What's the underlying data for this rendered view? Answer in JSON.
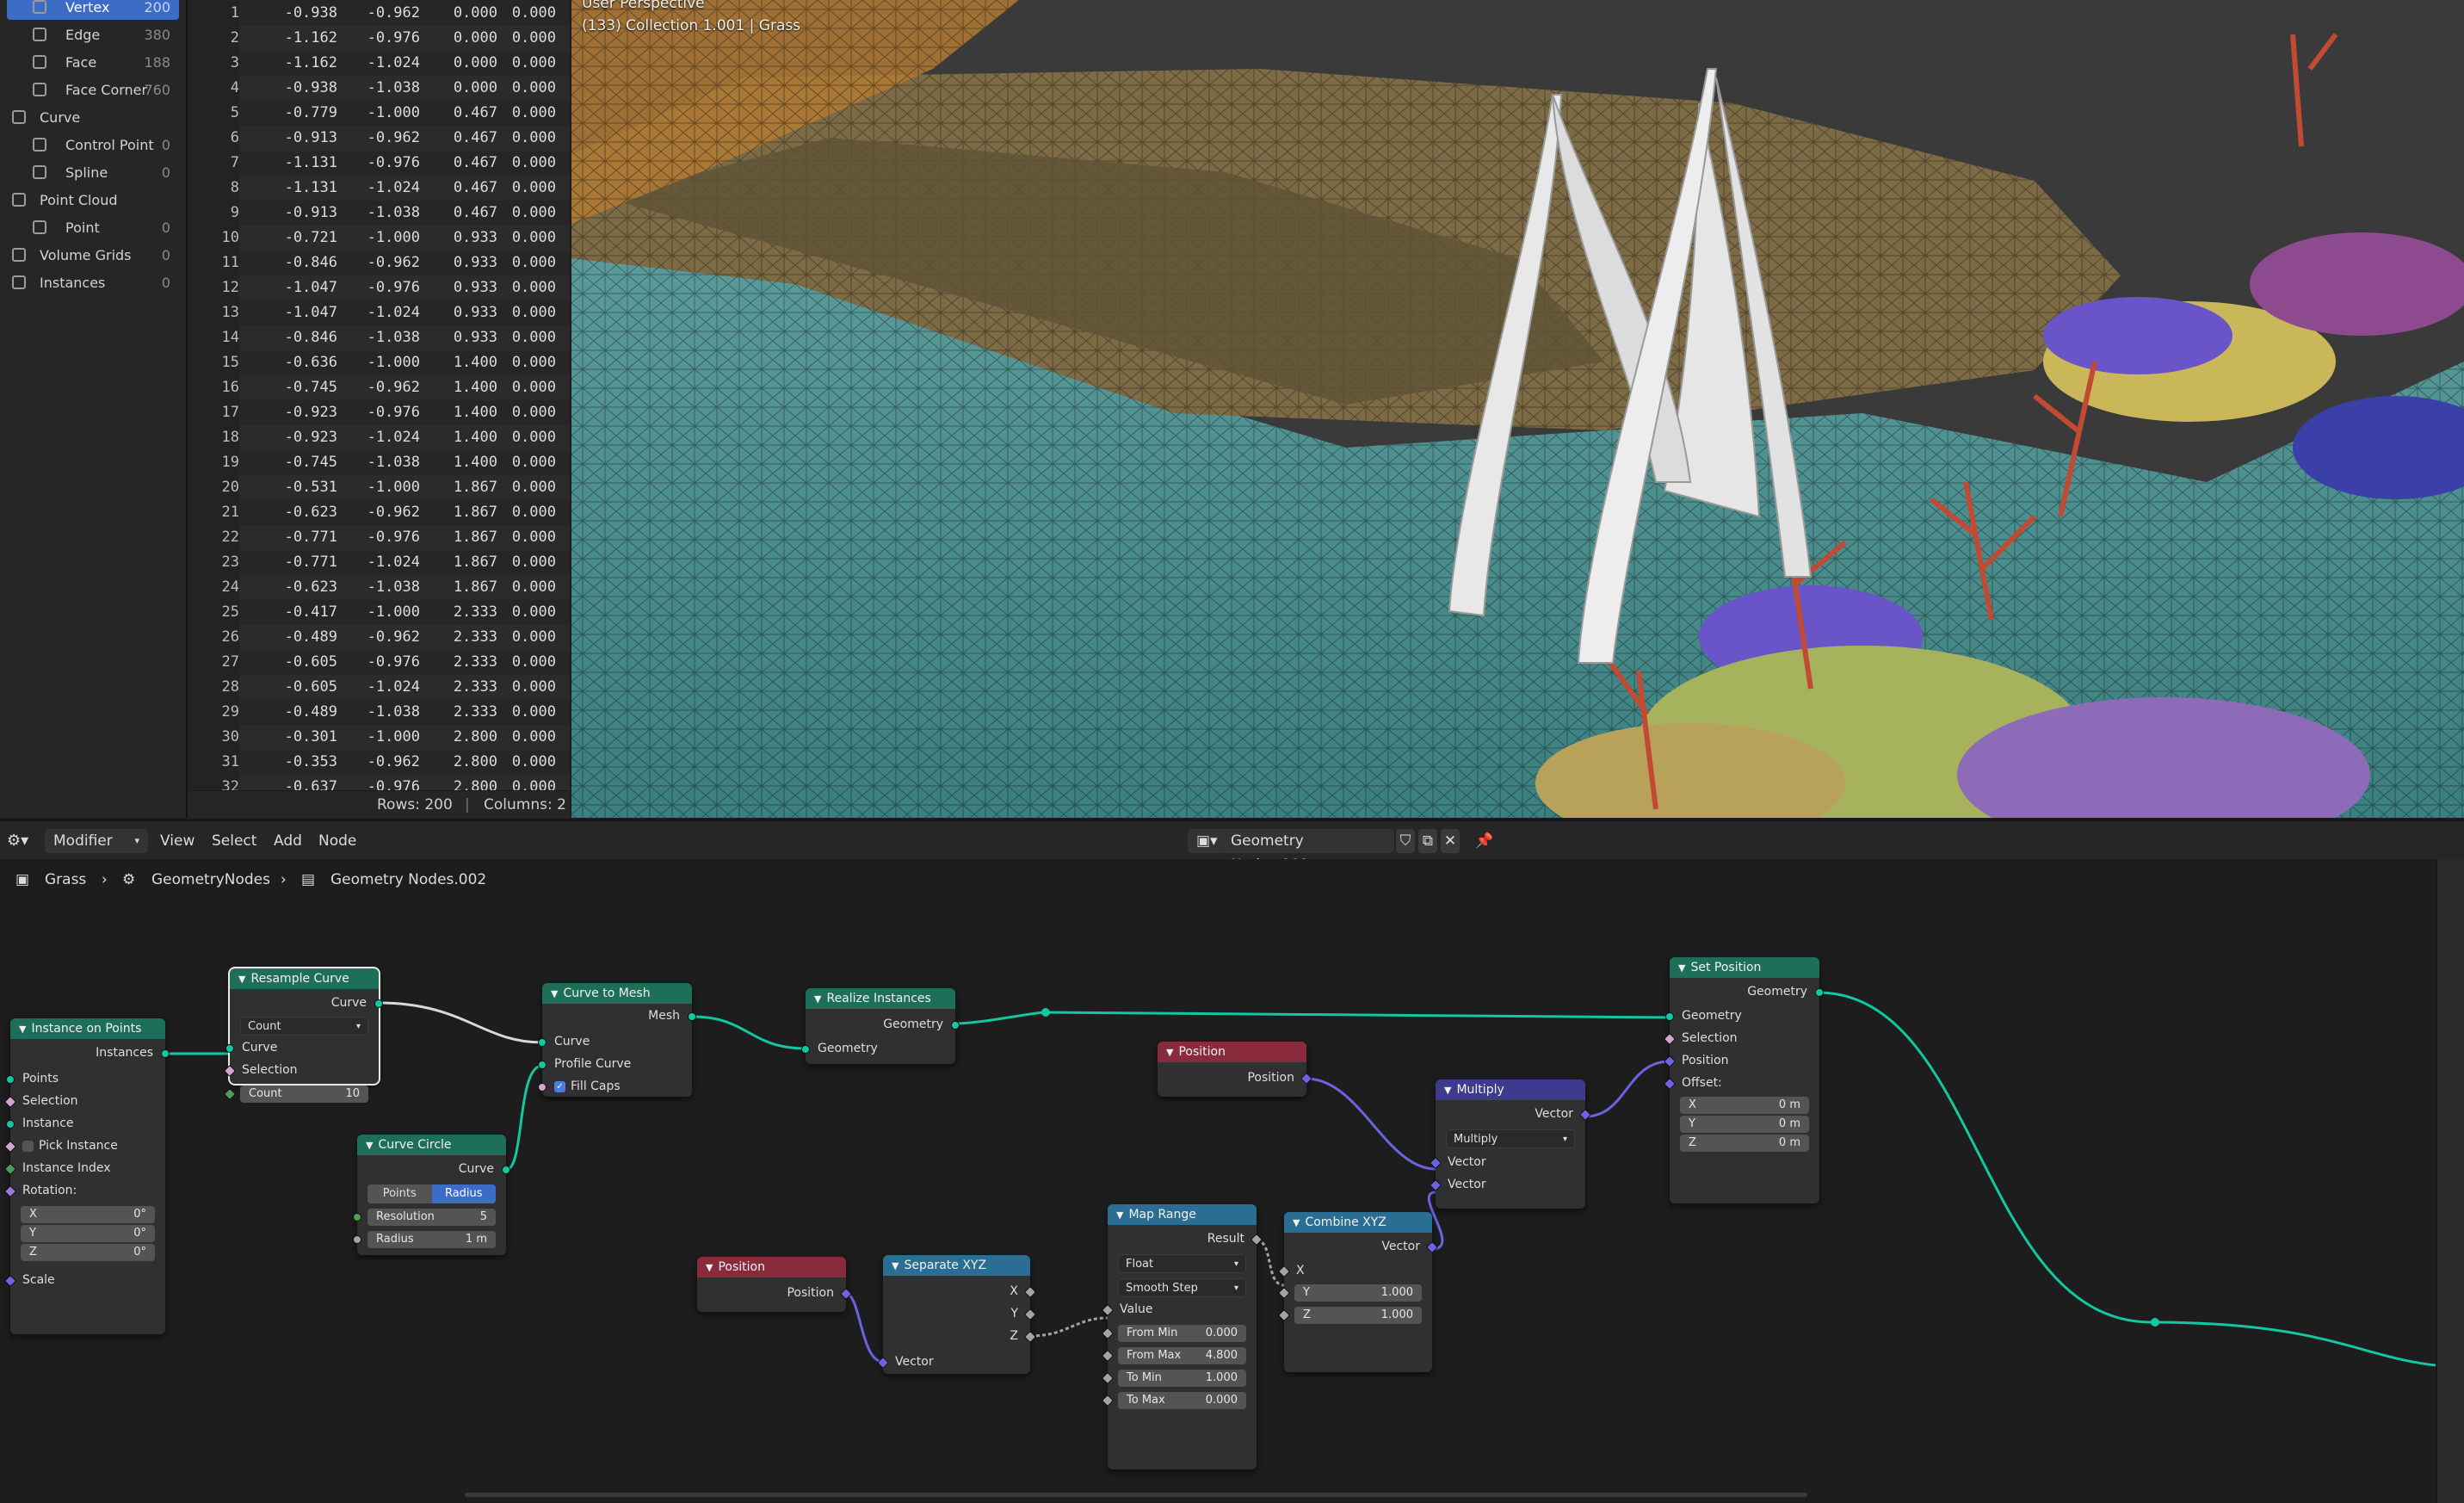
{
  "side_panel": {
    "items": [
      {
        "label": "Vertex",
        "count": "200",
        "icon": "vertex-icon",
        "active": true,
        "indent": true
      },
      {
        "label": "Edge",
        "count": "380",
        "icon": "edge-icon",
        "indent": true
      },
      {
        "label": "Face",
        "count": "188",
        "icon": "face-icon",
        "indent": true
      },
      {
        "label": "Face Corner",
        "count": "760",
        "icon": "face-corner-icon",
        "indent": true
      },
      {
        "label": "Curve",
        "count": "",
        "icon": "curve-icon",
        "indent": false
      },
      {
        "label": "Control Point",
        "count": "0",
        "icon": "control-point-icon",
        "indent": true
      },
      {
        "label": "Spline",
        "count": "0",
        "icon": "spline-icon",
        "indent": true
      },
      {
        "label": "Point Cloud",
        "count": "",
        "icon": "point-cloud-icon",
        "indent": false
      },
      {
        "label": "Point",
        "count": "0",
        "icon": "point-icon",
        "indent": true
      },
      {
        "label": "Volume Grids",
        "count": "0",
        "icon": "volume-grids-icon",
        "indent": false
      },
      {
        "label": "Instances",
        "count": "0",
        "icon": "instances-icon",
        "indent": false
      }
    ]
  },
  "spreadsheet": {
    "rows": [
      [
        "1",
        "-0.938",
        "-0.962",
        "0.000",
        "0.000"
      ],
      [
        "2",
        "-1.162",
        "-0.976",
        "0.000",
        "0.000"
      ],
      [
        "3",
        "-1.162",
        "-1.024",
        "0.000",
        "0.000"
      ],
      [
        "4",
        "-0.938",
        "-1.038",
        "0.000",
        "0.000"
      ],
      [
        "5",
        "-0.779",
        "-1.000",
        "0.467",
        "0.000"
      ],
      [
        "6",
        "-0.913",
        "-0.962",
        "0.467",
        "0.000"
      ],
      [
        "7",
        "-1.131",
        "-0.976",
        "0.467",
        "0.000"
      ],
      [
        "8",
        "-1.131",
        "-1.024",
        "0.467",
        "0.000"
      ],
      [
        "9",
        "-0.913",
        "-1.038",
        "0.467",
        "0.000"
      ],
      [
        "10",
        "-0.721",
        "-1.000",
        "0.933",
        "0.000"
      ],
      [
        "11",
        "-0.846",
        "-0.962",
        "0.933",
        "0.000"
      ],
      [
        "12",
        "-1.047",
        "-0.976",
        "0.933",
        "0.000"
      ],
      [
        "13",
        "-1.047",
        "-1.024",
        "0.933",
        "0.000"
      ],
      [
        "14",
        "-0.846",
        "-1.038",
        "0.933",
        "0.000"
      ],
      [
        "15",
        "-0.636",
        "-1.000",
        "1.400",
        "0.000"
      ],
      [
        "16",
        "-0.745",
        "-0.962",
        "1.400",
        "0.000"
      ],
      [
        "17",
        "-0.923",
        "-0.976",
        "1.400",
        "0.000"
      ],
      [
        "18",
        "-0.923",
        "-1.024",
        "1.400",
        "0.000"
      ],
      [
        "19",
        "-0.745",
        "-1.038",
        "1.400",
        "0.000"
      ],
      [
        "20",
        "-0.531",
        "-1.000",
        "1.867",
        "0.000"
      ],
      [
        "21",
        "-0.623",
        "-0.962",
        "1.867",
        "0.000"
      ],
      [
        "22",
        "-0.771",
        "-0.976",
        "1.867",
        "0.000"
      ],
      [
        "23",
        "-0.771",
        "-1.024",
        "1.867",
        "0.000"
      ],
      [
        "24",
        "-0.623",
        "-1.038",
        "1.867",
        "0.000"
      ],
      [
        "25",
        "-0.417",
        "-1.000",
        "2.333",
        "0.000"
      ],
      [
        "26",
        "-0.489",
        "-0.962",
        "2.333",
        "0.000"
      ],
      [
        "27",
        "-0.605",
        "-0.976",
        "2.333",
        "0.000"
      ],
      [
        "28",
        "-0.605",
        "-1.024",
        "2.333",
        "0.000"
      ],
      [
        "29",
        "-0.489",
        "-1.038",
        "2.333",
        "0.000"
      ],
      [
        "30",
        "-0.301",
        "-1.000",
        "2.800",
        "0.000"
      ],
      [
        "31",
        "-0.353",
        "-0.962",
        "2.800",
        "0.000"
      ],
      [
        "32",
        "-0.637",
        "-0.976",
        "2.800",
        "0.000"
      ]
    ],
    "footer_rows": "Rows: 200",
    "footer_sep": "|",
    "footer_columns": "Columns: 2"
  },
  "viewport": {
    "perspective": "User Perspective",
    "collection": "(133) Collection 1.001 | Grass"
  },
  "node_header": {
    "editor_type_icon": "node-editor-icon",
    "mode": "Modifier",
    "menus": [
      "View",
      "Select",
      "Add",
      "Node"
    ],
    "tree_name": "Geometry Nodes.002",
    "icons": [
      "shield-icon",
      "duplicate-icon",
      "close-icon",
      "pin-icon"
    ]
  },
  "breadcrumbs": [
    "Grass",
    "GeometryNodes",
    "Geometry Nodes.002"
  ],
  "nodes": {
    "instance_on_points": {
      "title": "Instance on Points",
      "out_instances": "Instances",
      "in_points": "Points",
      "in_selection": "Selection",
      "in_instance": "Instance",
      "pick_instance": "Pick Instance",
      "in_instance_index": "Instance Index",
      "rotation_label": "Rotation:",
      "rot_x": {
        "l": "X",
        "v": "0°"
      },
      "rot_y": {
        "l": "Y",
        "v": "0°"
      },
      "rot_z": {
        "l": "Z",
        "v": "0°"
      },
      "in_scale": "Scale"
    },
    "resample_curve": {
      "title": "Resample Curve",
      "out_curve": "Curve",
      "mode": "Count",
      "in_curve": "Curve",
      "in_selection": "Selection",
      "count": {
        "l": "Count",
        "v": "10"
      }
    },
    "curve_circle": {
      "title": "Curve Circle",
      "out_curve": "Curve",
      "mode_a": "Points",
      "mode_b": "Radius",
      "resolution": {
        "l": "Resolution",
        "v": "5"
      },
      "radius": {
        "l": "Radius",
        "v": "1 m"
      }
    },
    "curve_to_mesh": {
      "title": "Curve to Mesh",
      "out_mesh": "Mesh",
      "in_curve": "Curve",
      "in_profile": "Profile Curve",
      "fill_caps": "Fill Caps"
    },
    "realize_instances": {
      "title": "Realize Instances",
      "out_geometry": "Geometry",
      "in_geometry": "Geometry"
    },
    "position_a": {
      "title": "Position",
      "out_position": "Position"
    },
    "position_b": {
      "title": "Position",
      "out_position": "Position"
    },
    "separate_xyz": {
      "title": "Separate XYZ",
      "out_x": "X",
      "out_y": "Y",
      "out_z": "Z",
      "in_vector": "Vector"
    },
    "map_range": {
      "title": "Map Range",
      "out_result": "Result",
      "data_type": "Float",
      "interp": "Smooth Step",
      "in_value": "Value",
      "from_min": {
        "l": "From Min",
        "v": "0.000"
      },
      "from_max": {
        "l": "From Max",
        "v": "4.800"
      },
      "to_min": {
        "l": "To Min",
        "v": "1.000"
      },
      "to_max": {
        "l": "To Max",
        "v": "0.000"
      }
    },
    "combine_xyz": {
      "title": "Combine XYZ",
      "out_vector": "Vector",
      "in_x": "X",
      "y": {
        "l": "Y",
        "v": "1.000"
      },
      "z": {
        "l": "Z",
        "v": "1.000"
      }
    },
    "multiply": {
      "title": "Multiply",
      "out_vector": "Vector",
      "op": "Multiply",
      "in_vector_a": "Vector",
      "in_vector_b": "Vector"
    },
    "set_position": {
      "title": "Set Position",
      "out_geometry": "Geometry",
      "in_geometry": "Geometry",
      "in_selection": "Selection",
      "in_position": "Position",
      "offset_label": "Offset:",
      "off_x": {
        "l": "X",
        "v": "0 m"
      },
      "off_y": {
        "l": "Y",
        "v": "0 m"
      },
      "off_z": {
        "l": "Z",
        "v": "0 m"
      }
    }
  },
  "colors": {
    "geometry_header": "#1e6f5a",
    "input_header": "#8a2a3d",
    "converter_header": "#2a6f93",
    "vector_header": "#3d3a8f",
    "geometry_socket": "#13c7a1",
    "vector_socket": "#6b63e0",
    "selection_blue": "#3d6cc6"
  }
}
